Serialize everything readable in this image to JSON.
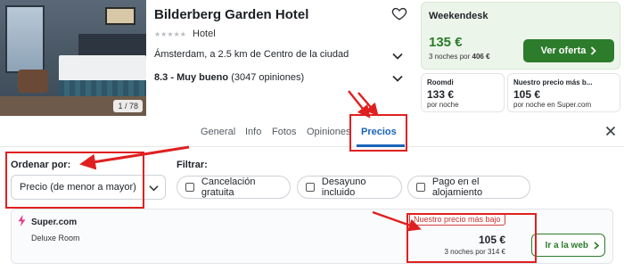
{
  "hotel": {
    "name": "Bilderberg Garden Hotel",
    "stars_glyphs": "★★★★★",
    "type": "Hotel",
    "location": "Ámsterdam, a 2.5 km de Centro de la ciudad",
    "rating_score": "8.3 - Muy bueno",
    "rating_count": "(3047 opiniones)",
    "photo_counter": "1 / 78"
  },
  "main_deal": {
    "provider": "Weekendesk",
    "price": "135 €",
    "nights_prefix": "3 noches por",
    "nights_total": "406 €",
    "cta_label": "Ver oferta"
  },
  "small_deals": [
    {
      "provider": "Roomdi",
      "price": "133 €",
      "sub": "por noche"
    },
    {
      "provider": "Nuestro precio más b...",
      "price": "105 €",
      "sub": "por noche en Super.com"
    }
  ],
  "tabs": [
    "General",
    "Info",
    "Fotos",
    "Opiniones",
    "Precios"
  ],
  "active_tab": "Precios",
  "sort": {
    "label": "Ordenar por:",
    "value": "Precio (de menor a mayor)"
  },
  "filters": {
    "label": "Filtrar:",
    "options": [
      "Cancelación gratuita",
      "Desayuno incluido",
      "Pago en el alojamiento"
    ]
  },
  "offer": {
    "provider": "Super.com",
    "room": "Deluxe Room",
    "badge": "Nuestro precio más bajo",
    "price": "105 €",
    "nights": "3 noches por 314 €",
    "cta_label": "Ir a la web"
  },
  "colors": {
    "accent_green": "#2c7c2c",
    "price_green": "#2a7a2a",
    "active_tab_blue": "#1a64b8",
    "annotation_red": "#e02020",
    "badge_red": "#c62f2f"
  },
  "icons": {
    "favorite": "heart-icon",
    "expand": "chevron-down-icon",
    "close": "close-icon",
    "provider": "lightning-bolt-icon",
    "cta": "chevron-right-icon"
  }
}
